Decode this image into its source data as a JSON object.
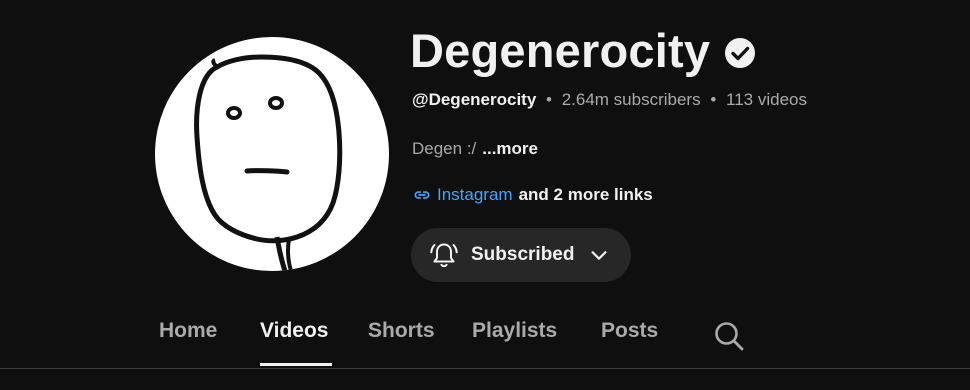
{
  "channel": {
    "name": "Degenerocity",
    "handle": "@Degenerocity",
    "subscribers": "2.64m subscribers",
    "videos": "113 videos",
    "separator": "•",
    "description": "Degen :/",
    "more_label": "...more",
    "link_primary": "Instagram",
    "link_more": "and 2 more links",
    "verified_icon": "verified-check-icon",
    "avatar_icon": "poker-face-meme-avatar"
  },
  "subscribe": {
    "label": "Subscribed",
    "bell_icon": "bell-ringing-icon",
    "chevron_icon": "chevron-down-icon"
  },
  "tabs": [
    {
      "label": "Home",
      "active": false
    },
    {
      "label": "Videos",
      "active": true
    },
    {
      "label": "Shorts",
      "active": false
    },
    {
      "label": "Playlists",
      "active": false
    },
    {
      "label": "Posts",
      "active": false
    }
  ],
  "search_icon": "search-icon",
  "colors": {
    "background": "#0f0f0f",
    "text_primary": "#f1f1f1",
    "text_secondary": "#aaaaaa",
    "link": "#3ea6ff",
    "button_bg": "#272727"
  }
}
